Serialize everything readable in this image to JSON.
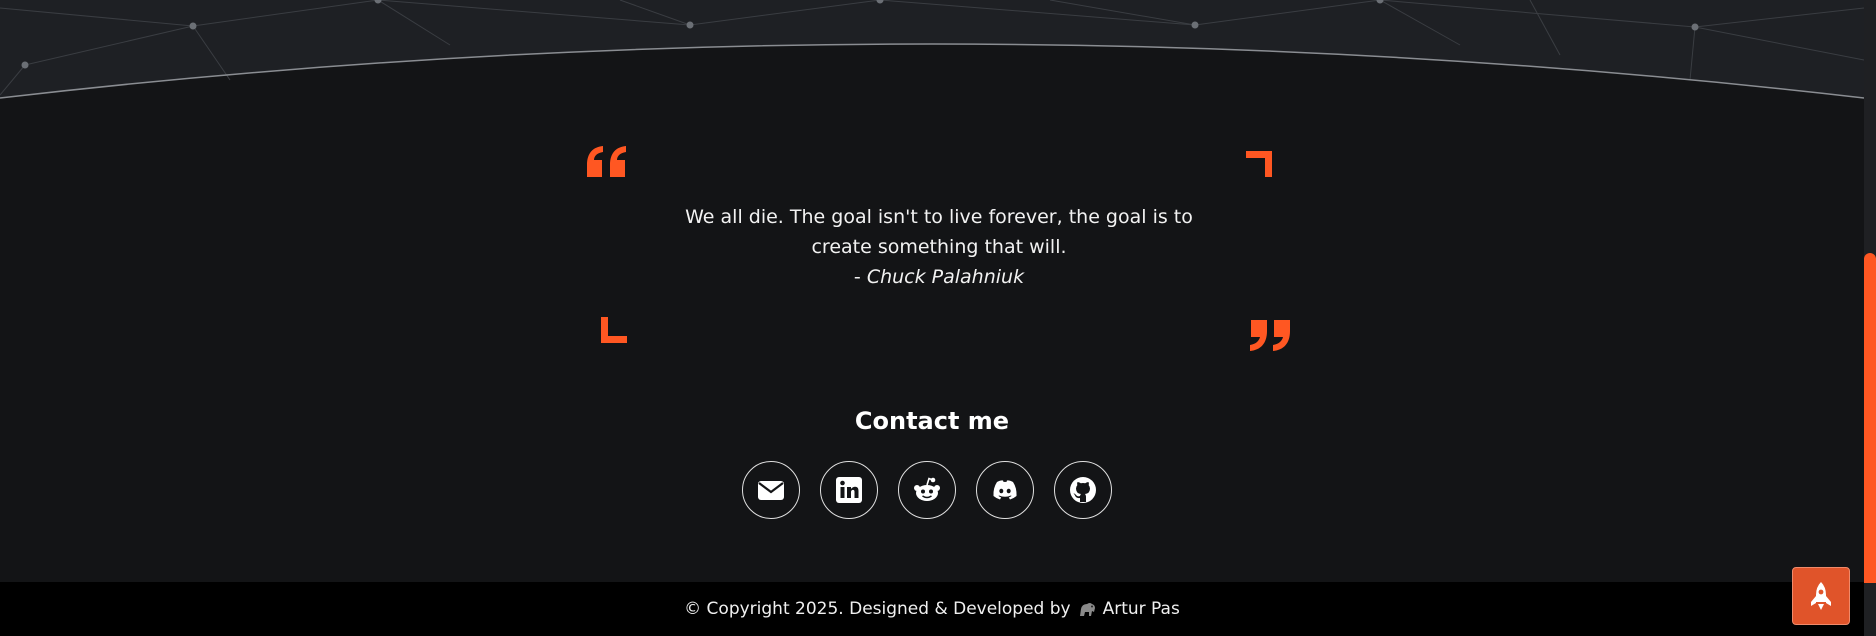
{
  "quote": {
    "text": "We all die. The goal isn't to live forever, the goal is to create something that will.",
    "author_prefix": "- ",
    "author": "Chuck Palahniuk"
  },
  "contact": {
    "title": "Contact me",
    "links": [
      {
        "name": "email",
        "icon": "envelope-icon"
      },
      {
        "name": "linkedin",
        "icon": "linkedin-icon"
      },
      {
        "name": "reddit",
        "icon": "reddit-icon"
      },
      {
        "name": "discord",
        "icon": "discord-icon"
      },
      {
        "name": "github",
        "icon": "github-icon"
      }
    ]
  },
  "footer": {
    "copyright": "© Copyright 2025. Designed & Developed by",
    "author": "Artur Pas"
  },
  "scroll_top": {
    "icon": "rocket-icon"
  },
  "colors": {
    "accent": "#ff5722",
    "background": "#131416",
    "footer": "#000000",
    "rocket_button": "#e0542a"
  }
}
